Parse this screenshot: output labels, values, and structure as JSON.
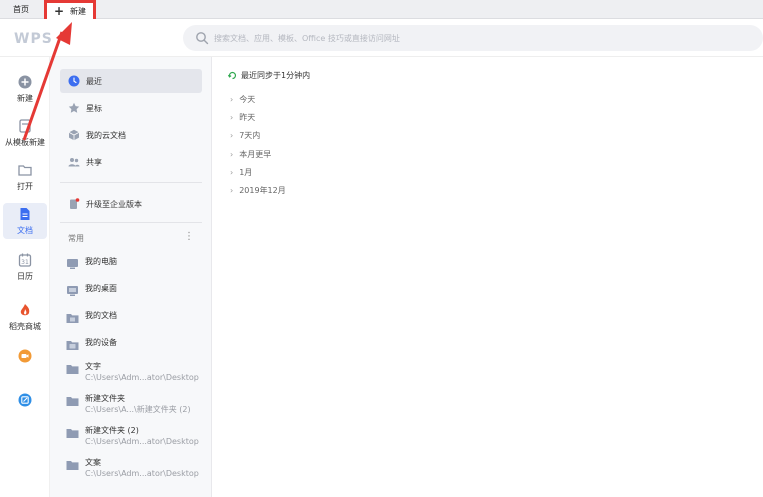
{
  "tabs": {
    "home": "首页",
    "new_tab": "新建",
    "new_tab_icon": "plus-icon"
  },
  "header": {
    "logo": "WPS",
    "search_placeholder": "搜索文档、应用、模板、Office 技巧或直接访问网址"
  },
  "rail": {
    "items": [
      {
        "label": "新建",
        "icon": "plus-circle-icon"
      },
      {
        "label": "从模板新建",
        "icon": "template-icon"
      },
      {
        "label": "打开",
        "icon": "folder-icon"
      },
      {
        "label": "文档",
        "icon": "document-icon"
      },
      {
        "label": "日历",
        "icon": "calendar-icon"
      },
      {
        "label": "稻壳商城",
        "icon": "docer-icon"
      },
      {
        "label": "",
        "icon": "video-meeting-icon"
      },
      {
        "label": "",
        "icon": "edit-app-icon"
      }
    ]
  },
  "nav": {
    "items": [
      {
        "label": "最近",
        "icon": "clock-icon"
      },
      {
        "label": "星标",
        "icon": "star-icon"
      },
      {
        "label": "我的云文档",
        "icon": "cloud-box-icon"
      },
      {
        "label": "共享",
        "icon": "share-users-icon"
      },
      {
        "label": "升级至企业版本",
        "icon": "upgrade-icon"
      }
    ],
    "section_title": "常用",
    "section_more": "⋮",
    "places": [
      {
        "title": "我的电脑",
        "sub": "",
        "icon": "computer-icon"
      },
      {
        "title": "我的桌面",
        "sub": "",
        "icon": "desktop-icon"
      },
      {
        "title": "我的文档",
        "sub": "",
        "icon": "documents-folder-icon"
      },
      {
        "title": "我的设备",
        "sub": "",
        "icon": "device-icon"
      },
      {
        "title": "文字",
        "sub": "C:\\Users\\Adm...ator\\Desktop",
        "icon": "folder-icon"
      },
      {
        "title": "新建文件夹",
        "sub": "C:\\Users\\A...\\新建文件夹 (2)",
        "icon": "folder-icon"
      },
      {
        "title": "新建文件夹 (2)",
        "sub": "C:\\Users\\Adm...ator\\Desktop",
        "icon": "folder-icon"
      },
      {
        "title": "文案",
        "sub": "C:\\Users\\Adm...ator\\Desktop",
        "icon": "folder-icon"
      }
    ]
  },
  "main": {
    "sync_text": "最近同步于1分钟内",
    "groups": [
      "今天",
      "昨天",
      "7天内",
      "本月更早",
      "1月",
      "2019年12月"
    ]
  },
  "colors": {
    "accent": "#3c6ef0",
    "annotation_red": "#e53935"
  }
}
